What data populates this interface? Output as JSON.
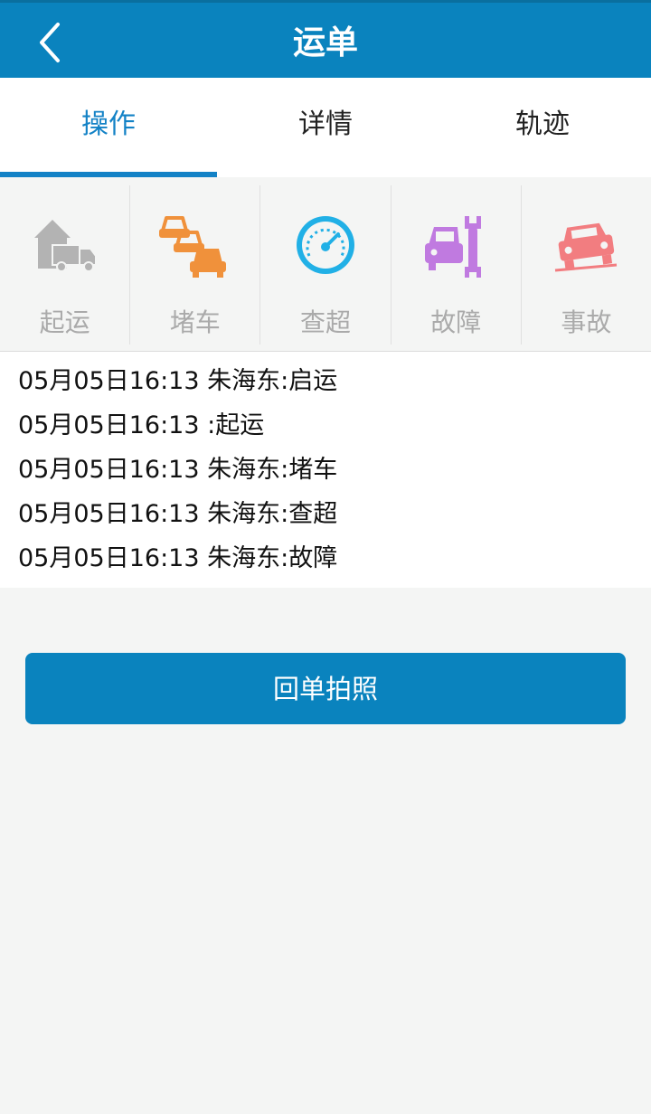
{
  "header": {
    "title": "运单",
    "back_icon": "chevron-left-icon"
  },
  "tabs": [
    {
      "label": "操作",
      "active": true
    },
    {
      "label": "详情",
      "active": false
    },
    {
      "label": "轨迹",
      "active": false
    }
  ],
  "operations": [
    {
      "label": "起运",
      "icon": "truck-warehouse-icon",
      "color": "#b3b3b3"
    },
    {
      "label": "堵车",
      "icon": "traffic-jam-icon",
      "color": "#f0913b"
    },
    {
      "label": "查超",
      "icon": "speedometer-icon",
      "color": "#21b0e6"
    },
    {
      "label": "故障",
      "icon": "wrench-car-icon",
      "color": "#c07ae0"
    },
    {
      "label": "事故",
      "icon": "car-accident-icon",
      "color": "#f27d80"
    }
  ],
  "logs": [
    "05月05日16:13 朱海东:启运",
    "05月05日16:13 :起运",
    "05月05日16:13 朱海东:堵车",
    "05月05日16:13 朱海东:查超",
    "05月05日16:13 朱海东:故障"
  ],
  "action_button": {
    "label": "回单拍照"
  },
  "colors": {
    "primary": "#0a83be",
    "tab_active": "#1382c6"
  }
}
